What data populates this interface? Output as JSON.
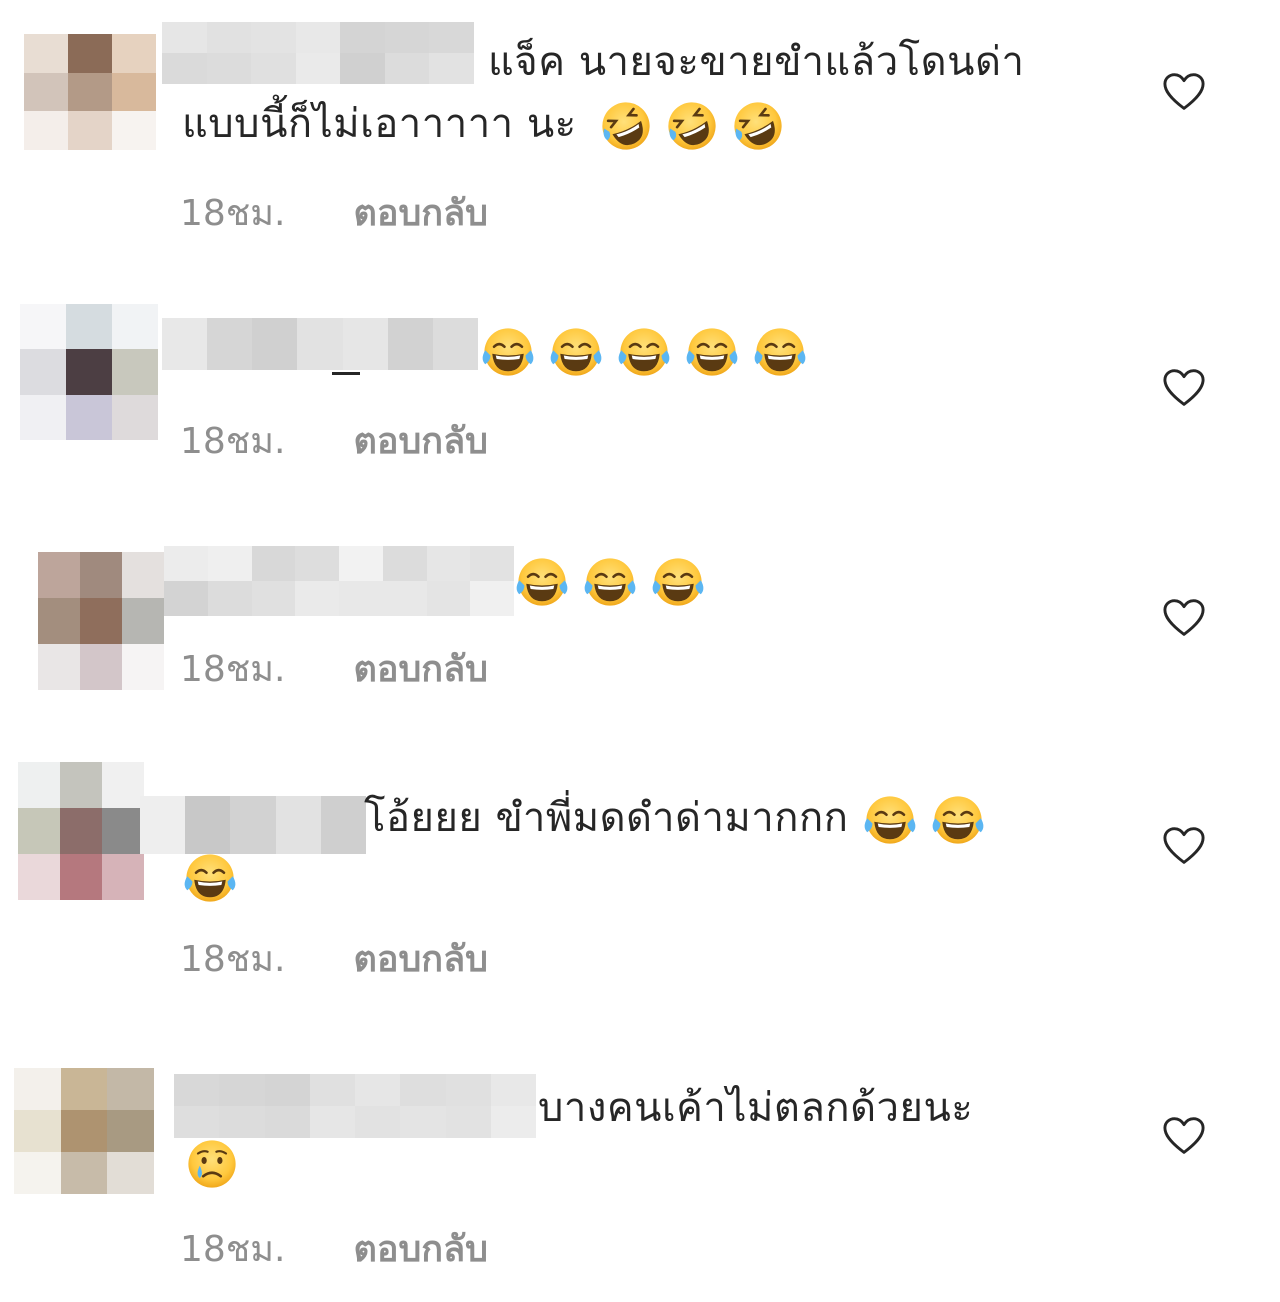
{
  "comments": [
    {
      "text_line1": "แจ็ค นายจะขายขำแล้วโดนด่า",
      "text_line2": "แบบนี้ก็ไม่เอาาาาา นะ",
      "emoji": [
        "rofl-emoji",
        "rofl-emoji",
        "rofl-emoji"
      ],
      "time": "18ชม.",
      "reply_label": "ตอบกลับ",
      "like_icon": "heart-outline-icon"
    },
    {
      "text_line1": "",
      "emoji": [
        "tears-of-joy-emoji",
        "tears-of-joy-emoji",
        "tears-of-joy-emoji",
        "tears-of-joy-emoji",
        "tears-of-joy-emoji"
      ],
      "time": "18ชม.",
      "reply_label": "ตอบกลับ",
      "like_icon": "heart-outline-icon"
    },
    {
      "text_line1": "",
      "emoji": [
        "tears-of-joy-emoji",
        "tears-of-joy-emoji",
        "tears-of-joy-emoji"
      ],
      "time": "18ชม.",
      "reply_label": "ตอบกลับ",
      "like_icon": "heart-outline-icon"
    },
    {
      "text_line1": "โอ้ยยย ขำพี่มดดำด่ามากกก",
      "emoji": [
        "tears-of-joy-emoji",
        "tears-of-joy-emoji",
        "tears-of-joy-emoji"
      ],
      "time": "18ชม.",
      "reply_label": "ตอบกลับ",
      "like_icon": "heart-outline-icon"
    },
    {
      "text_line1": "บางคนเค้าไม่ตลกด้วยนะ",
      "emoji": [
        "crying-face-emoji"
      ],
      "time": "18ชม.",
      "reply_label": "ตอบกลับ",
      "like_icon": "heart-outline-icon"
    }
  ],
  "colors": {
    "text": "#262626",
    "meta": "#8e8e8e",
    "heart_stroke": "#262626"
  }
}
